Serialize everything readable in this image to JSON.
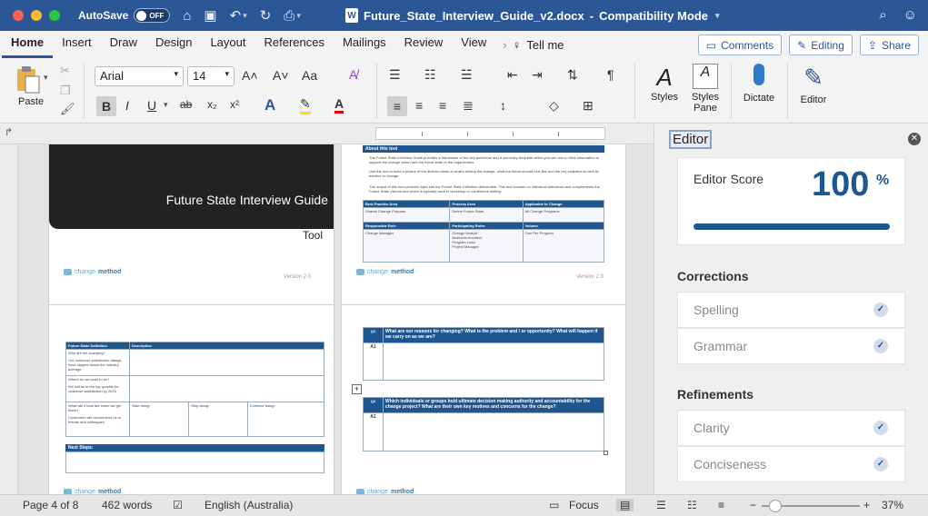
{
  "titlebar": {
    "autosave_label": "AutoSave",
    "autosave_state": "OFF",
    "doc_title": "Future_State_Interview_Guide_v2.docx",
    "separator": "-",
    "mode": "Compatibility Mode"
  },
  "tabs": [
    "Home",
    "Insert",
    "Draw",
    "Design",
    "Layout",
    "References",
    "Mailings",
    "Review",
    "View"
  ],
  "tell_me": "Tell me",
  "tab_buttons": {
    "comments": "Comments",
    "editing": "Editing",
    "share": "Share"
  },
  "ribbon": {
    "paste_label": "Paste",
    "font_name": "Arial",
    "font_size": "14",
    "styles_label": "Styles",
    "styles_pane_label": "Styles\nPane",
    "dictate_label": "Dictate",
    "editor_label": "Editor",
    "grow_font": "A˄",
    "shrink_font": "A˅",
    "change_case": "Aa",
    "bold": "B",
    "italic": "I",
    "underline": "U",
    "strike": "ab",
    "subscript": "x₂",
    "superscript": "x²",
    "pilcrow": "¶"
  },
  "pages": {
    "cover_title": "Future State Interview Guide",
    "cover_sub": "Tool",
    "logo_text_a": "change",
    "logo_text_b": "method",
    "version": "Version 2.0",
    "p2": {
      "about_header": "About this tool",
      "bullet1": "The Future State Interview Guide provides a framework of ten key questions and a summary template which you can use to elicit information to support the change vision and the future state of the organization.",
      "bullet2": "Use the tool to build a picture of the diverse views of what's driving the change, what the future should look like and the key enablers as well as barriers to change.",
      "bullet3": "The output of this tool provides input into the Future State Definition deliverable. This tool focuses on individual interviews and complements the Future State Visions tool which is typically used in workshop or conference setting.",
      "row1_headers": [
        "Best Practice Area",
        "Process Area",
        "Applicable to Change"
      ],
      "row1_values": [
        "Shared Change Purpose",
        "Define Future State",
        "All Change Programs"
      ],
      "row2_headers": [
        "Responsible Role",
        "Participating Roles",
        "Volume"
      ],
      "row2_values": [
        "Change Manager",
        "Change Analyst\nBusiness Architect\nProgram Lead\nProject Manager",
        "One Per Program"
      ]
    },
    "p3": {
      "col1": "Future State Definition",
      "col2": "Description",
      "q1": "Why are we changing?",
      "a1": "Our customer satisfaction ratings have slipped below the industry average",
      "q2": "Where do we want to be?",
      "a2": "We will be in the top quartile for customer satisfaction by 2015",
      "q3": "What will it look like when we get there?",
      "a3": "Customers will recommend us to friends and colleagues",
      "start": "Start doing:",
      "stop": "Stop doing:",
      "cont": "Continue doing:",
      "next": "Next Steps:"
    },
    "p4": {
      "q1_label": "Q1",
      "q1_text": "What are our reasons for changing? What is the problem and / or opportunity? What will happen if we carry on as we are?",
      "a1_label": "A1",
      "q2_label": "Q2",
      "q2_text": "Which individuals or groups hold ultimate decision making authority and accountability for the change project? What are their own key motives and concerns for the change?",
      "a2_label": "A2"
    }
  },
  "editor_pane": {
    "title": "Editor",
    "score_label": "Editor Score",
    "score_value": "100",
    "score_unit": "%",
    "score_fraction": 1.0,
    "corrections_heading": "Corrections",
    "corrections": [
      "Spelling",
      "Grammar"
    ],
    "refinements_heading": "Refinements",
    "refinements": [
      "Clarity",
      "Conciseness"
    ]
  },
  "status": {
    "page": "Page 4 of 8",
    "words": "462 words",
    "language": "English (Australia)",
    "focus": "Focus",
    "zoom": "37%",
    "zoom_fraction": 0.14
  }
}
